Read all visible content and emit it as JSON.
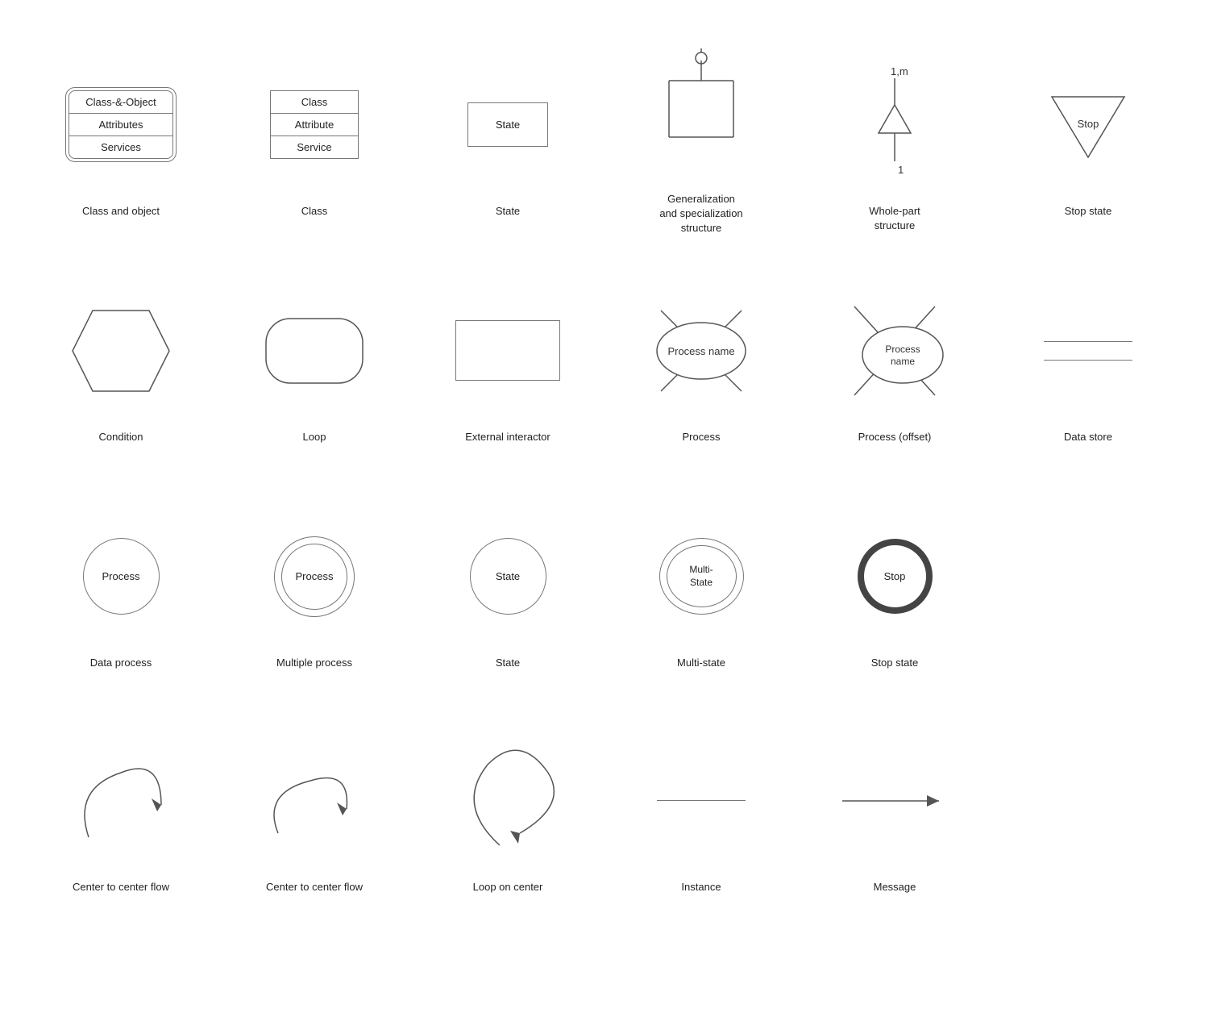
{
  "rows": [
    {
      "cells": [
        {
          "id": "class-object",
          "label": "Class and object",
          "shape": "class-object"
        },
        {
          "id": "class",
          "label": "Class",
          "shape": "class"
        },
        {
          "id": "state",
          "label": "State",
          "shape": "state-rect"
        },
        {
          "id": "generalization",
          "label": "Generalization\nand specialization\nstructure",
          "shape": "generalization"
        },
        {
          "id": "whole-part",
          "label": "Whole-part\nstructure",
          "shape": "whole-part"
        },
        {
          "id": "stop-state-tri",
          "label": "Stop state",
          "shape": "stop-triangle"
        }
      ]
    },
    {
      "cells": [
        {
          "id": "condition",
          "label": "Condition",
          "shape": "hexagon"
        },
        {
          "id": "loop",
          "label": "Loop",
          "shape": "loop-hex"
        },
        {
          "id": "external-interactor",
          "label": "External interactor",
          "shape": "ext-rect"
        },
        {
          "id": "process",
          "label": "Process",
          "shape": "process-ellipse"
        },
        {
          "id": "process-offset",
          "label": "Process (offset)",
          "shape": "process-ellipse-offset"
        },
        {
          "id": "data-store",
          "label": "Data store",
          "shape": "data-store-lines"
        }
      ]
    },
    {
      "cells": [
        {
          "id": "data-process",
          "label": "Data process",
          "shape": "circle-process",
          "text": "Process"
        },
        {
          "id": "multiple-process",
          "label": "Multiple process",
          "shape": "double-circle",
          "text": "Process"
        },
        {
          "id": "state-circle",
          "label": "State",
          "shape": "circle-state",
          "text": "State"
        },
        {
          "id": "multi-state",
          "label": "Multi-state",
          "shape": "double-ellipse",
          "text": "Multi-\nState"
        },
        {
          "id": "stop-state-circle",
          "label": "Stop state",
          "shape": "thick-circle",
          "text": "Stop"
        },
        {
          "id": "empty6",
          "label": "",
          "shape": "none"
        }
      ]
    },
    {
      "cells": [
        {
          "id": "center-flow-1",
          "label": "Center to center flow",
          "shape": "arc-flow-1"
        },
        {
          "id": "center-flow-2",
          "label": "Center to center flow",
          "shape": "arc-flow-2"
        },
        {
          "id": "loop-on-center",
          "label": "Loop on center",
          "shape": "loop-center"
        },
        {
          "id": "instance",
          "label": "Instance",
          "shape": "plain-line"
        },
        {
          "id": "message",
          "label": "Message",
          "shape": "arrow-line"
        },
        {
          "id": "empty7",
          "label": "",
          "shape": "none"
        }
      ]
    }
  ],
  "shapes": {
    "class-object": {
      "sections": [
        "Class-&-Object",
        "Attributes",
        "Services"
      ]
    },
    "class": {
      "sections": [
        "Class",
        "Attribute",
        "Service"
      ]
    },
    "state-rect": {
      "text": "State"
    },
    "stop-triangle": {
      "text": "Stop"
    },
    "process-ellipse": {
      "text": "Process name"
    },
    "process-ellipse-offset": {
      "text": "Process\nname"
    },
    "circle-process": {
      "text": "Process"
    },
    "double-circle": {
      "text": "Process"
    },
    "circle-state": {
      "text": "State"
    },
    "double-ellipse": {
      "text": "Multi-\nState"
    },
    "thick-circle": {
      "text": "Stop"
    }
  }
}
